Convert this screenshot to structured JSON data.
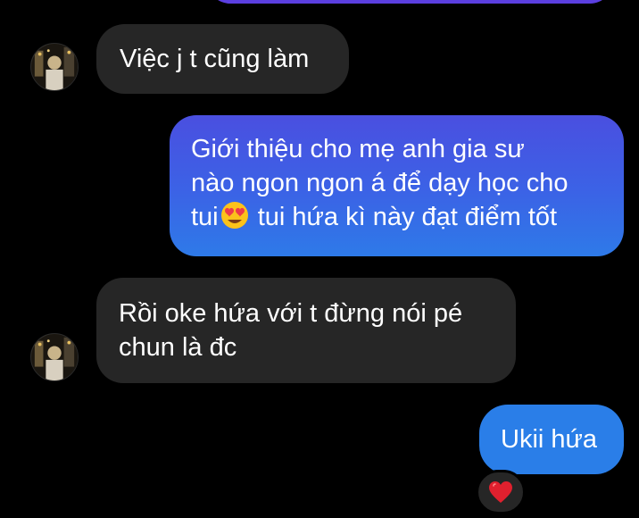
{
  "messages": [
    {
      "from": "other",
      "text": "Việc j t cũng làm"
    },
    {
      "from": "me",
      "lines": [
        "Giới thiệu cho mẹ anh gia sư",
        "nào ngon ngon á để dạy học cho"
      ],
      "line3_before_emoji": "tui",
      "line3_after_emoji": " tui hứa kì này đạt điểm tốt",
      "emoji": "heart-eyes-emoji"
    },
    {
      "from": "other",
      "lines": [
        "Rồi oke hứa với t đừng nói pé",
        "chun là đc"
      ]
    },
    {
      "from": "me",
      "text": "Ukii hứa",
      "reaction": "red-heart-icon"
    }
  ],
  "colors": {
    "background": "#000000",
    "incoming_bubble": "#262626",
    "outgoing_bubble_top": "#4a4fe0",
    "outgoing_bubble_bottom": "#2e7ae8",
    "reaction_heart": "#e0202e"
  }
}
